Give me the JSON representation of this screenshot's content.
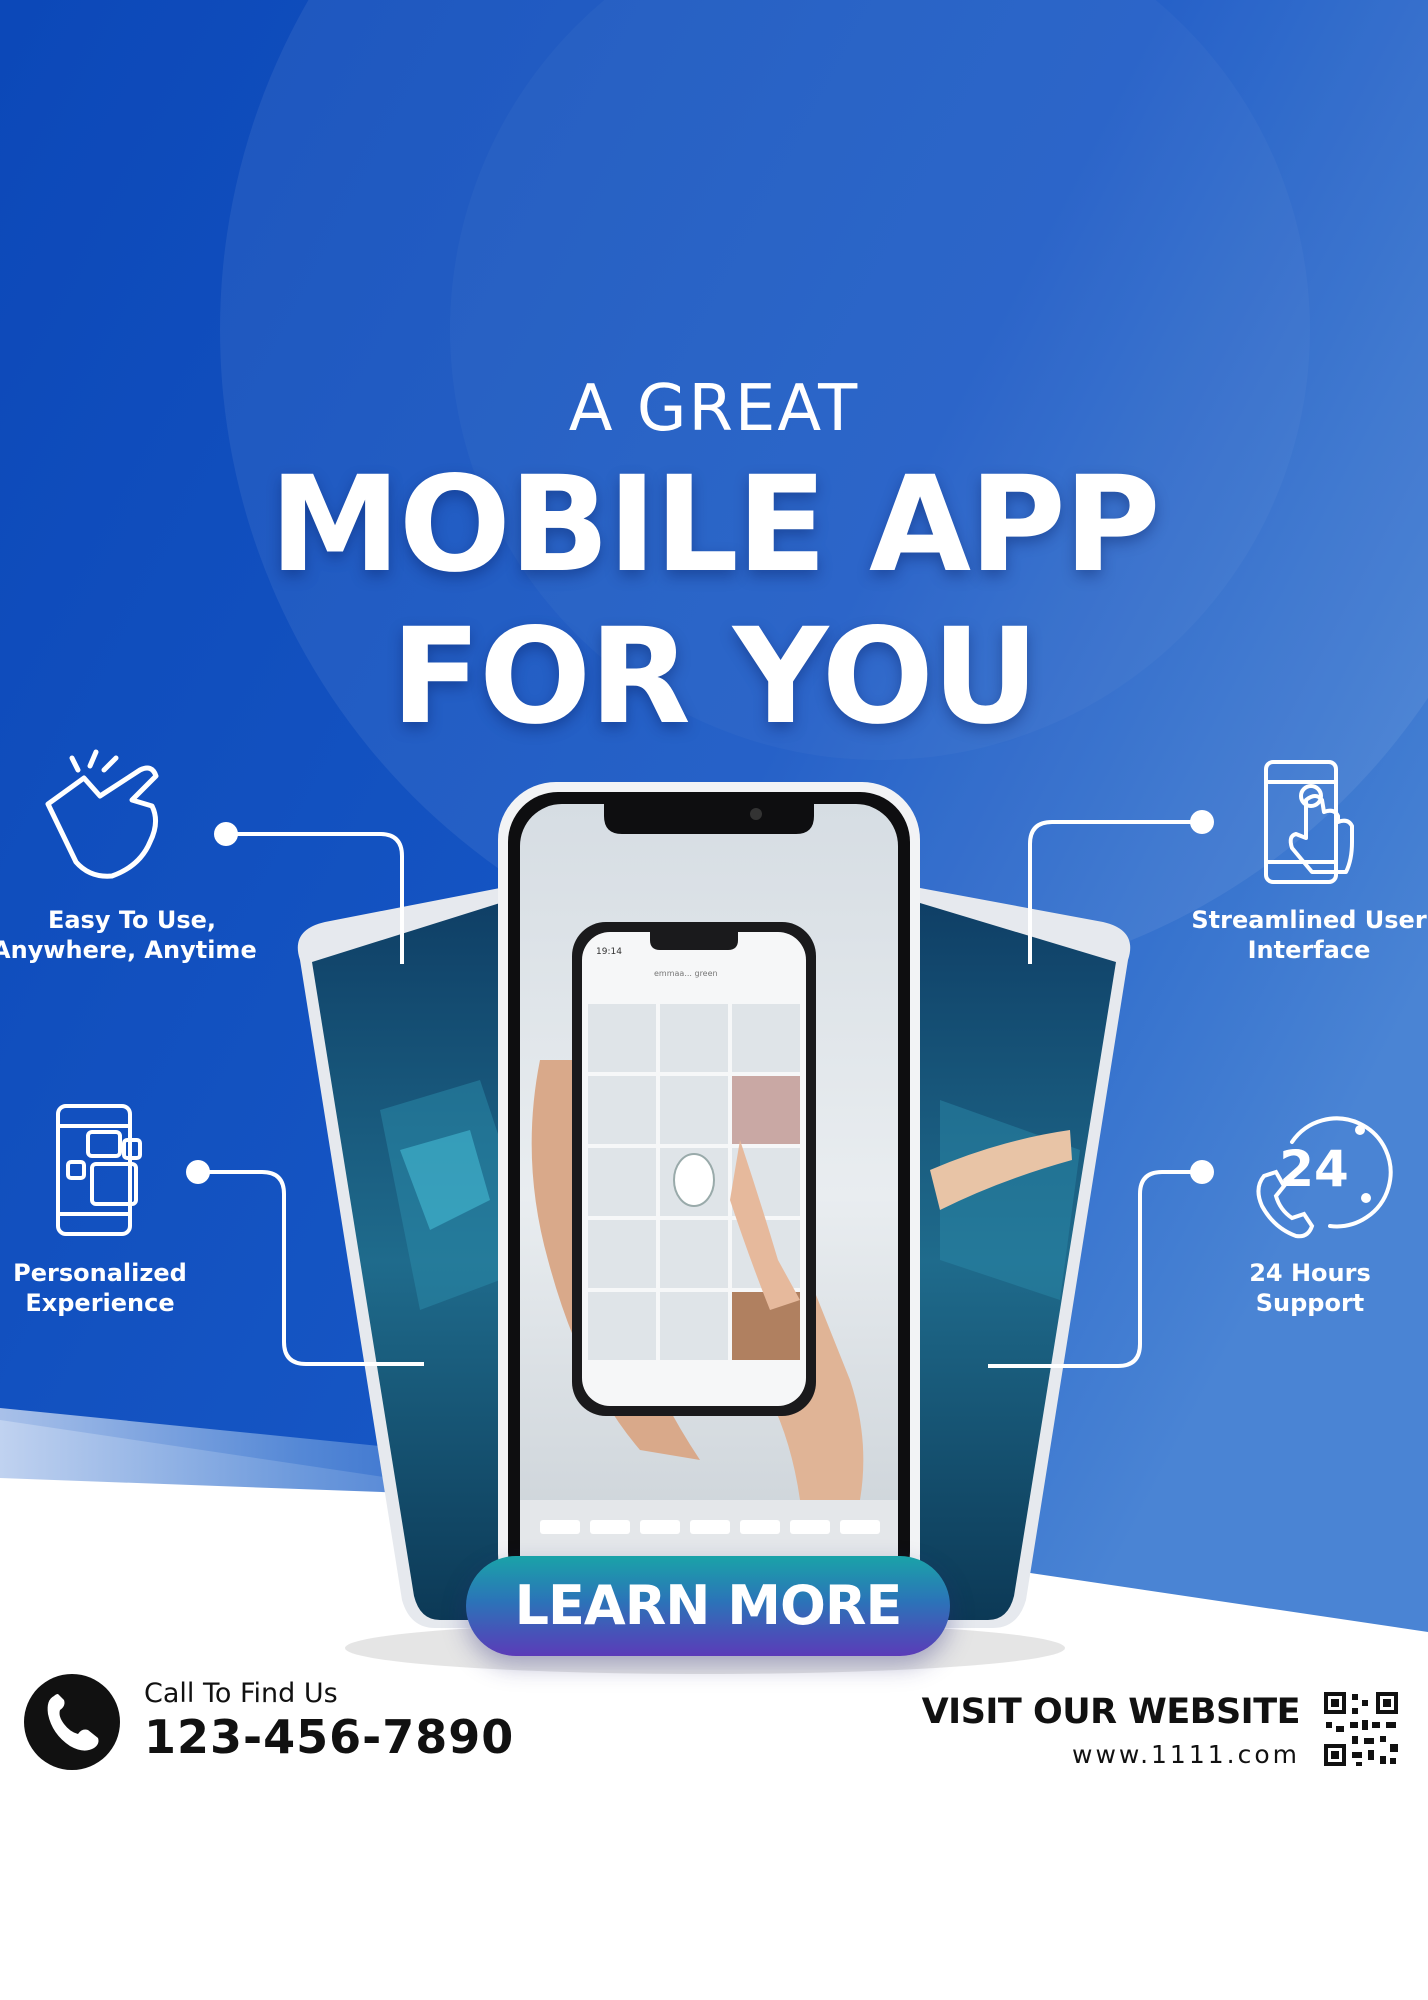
{
  "colors": {
    "background_blue": "#0d4fc0",
    "background_blue_light": "#3d7fd6",
    "white": "#ffffff",
    "text_dark": "#111111",
    "cta_gradient_start": "#1aa3a8",
    "cta_gradient_end": "#5b3bb8"
  },
  "headline": {
    "line1": "A GREAT",
    "line2": "MOBILE APP",
    "line3": "FOR YOU"
  },
  "features": {
    "easy": {
      "icon": "tap-gesture-icon",
      "line1": "Easy To Use,",
      "line2": "Anywhere, Anytime"
    },
    "personalized": {
      "icon": "phone-widgets-icon",
      "line1": "Personalized",
      "line2": "Experience"
    },
    "streamlined": {
      "icon": "touch-phone-icon",
      "line1": "Streamlined User",
      "line2": "Interface"
    },
    "support": {
      "icon": "24-hours-phone-icon",
      "icon_text": "24",
      "line1": "24 Hours",
      "line2": "Support"
    }
  },
  "phone_mockup": {
    "inner_phone_time": "19:14",
    "inner_phone_profile": "emmaa... green"
  },
  "cta": {
    "label": "LEARN MORE"
  },
  "contact": {
    "icon": "phone-icon",
    "caption": "Call To Find Us",
    "number": "123-456-7890"
  },
  "website": {
    "title": "VISIT OUR WEBSITE",
    "url": "www.1111.com",
    "icon": "qr-code-icon"
  }
}
